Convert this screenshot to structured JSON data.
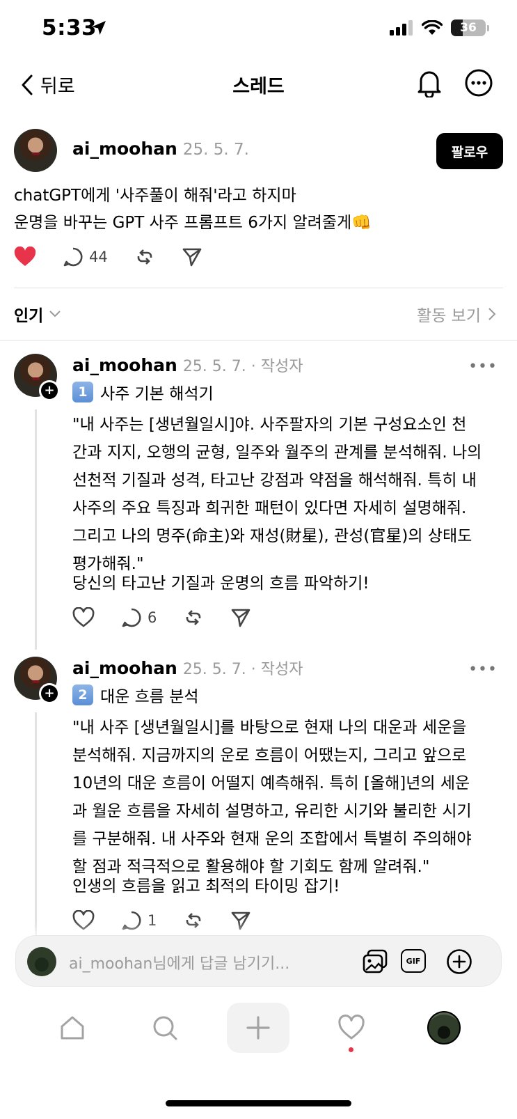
{
  "status": {
    "time": "5:33",
    "battery": "36"
  },
  "nav": {
    "back_label": "뒤로",
    "title": "스레드"
  },
  "post": {
    "author": "ai_moohan",
    "date": "25. 5. 7.",
    "follow_label": "팔로우",
    "lines": [
      "chatGPT에게 '사주풀이 해줘'라고 하지마",
      "운명을 바꾸는 GPT 사주 프롬프트 6가지 알려줄게👊"
    ],
    "reply_count": "44"
  },
  "sort": {
    "label": "인기",
    "activity_label": "활동 보기"
  },
  "replies": [
    {
      "author": "ai_moohan",
      "meta": "25. 5. 7. · 작성자",
      "badge": "1",
      "subtitle": "사주 기본 해석기",
      "lines": [
        "\"내 사주는 [생년월일시]야. 사주팔자의 기본 구성요소인 천",
        "간과 지지, 오행의 균형, 일주와 월주의 관계를 분석해줘. 나의",
        "선천적 기질과 성격, 타고난 강점과 약점을 해석해줘. 특히 내",
        "사주의 주요 특징과 희귀한 패턴이 있다면 자세히 설명해줘.",
        "그리고 나의 명주(命主)와 재성(財星), 관성(官星)의 상태도",
        "평가해줘.\""
      ],
      "summary": "당신의 타고난 기질과 운명의 흐름 파악하기!",
      "reply_count": "6"
    },
    {
      "author": "ai_moohan",
      "meta": "25. 5. 7. · 작성자",
      "badge": "2",
      "subtitle": "대운 흐름 분석",
      "lines": [
        "\"내 사주 [생년월일시]를 바탕으로 현재 나의 대운과 세운을",
        "분석해줘. 지금까지의 운로 흐름이 어땠는지, 그리고 앞으로",
        "10년의 대운 흐름이 어떨지 예측해줘. 특히 [올해]년의 세운",
        "과 월운 흐름을 자세히 설명하고, 유리한 시기와 불리한 시기",
        "를 구분해줘. 내 사주와 현재 운의 조합에서 특별히 주의해야",
        "할 점과 적극적으로 활용해야 할 기회도 함께 알려줘.\""
      ],
      "summary": "인생의 흐름을 읽고 최적의 타이밍 잡기!",
      "reply_count": "1"
    }
  ],
  "composer": {
    "placeholder": "ai_moohan님에게 답글 남기기...",
    "gif_label": "GIF"
  },
  "icons": {
    "like_filled_color": "#e8344a",
    "tabs": [
      "home-icon",
      "search-icon",
      "create-icon",
      "activity-heart-icon",
      "profile-avatar"
    ]
  }
}
